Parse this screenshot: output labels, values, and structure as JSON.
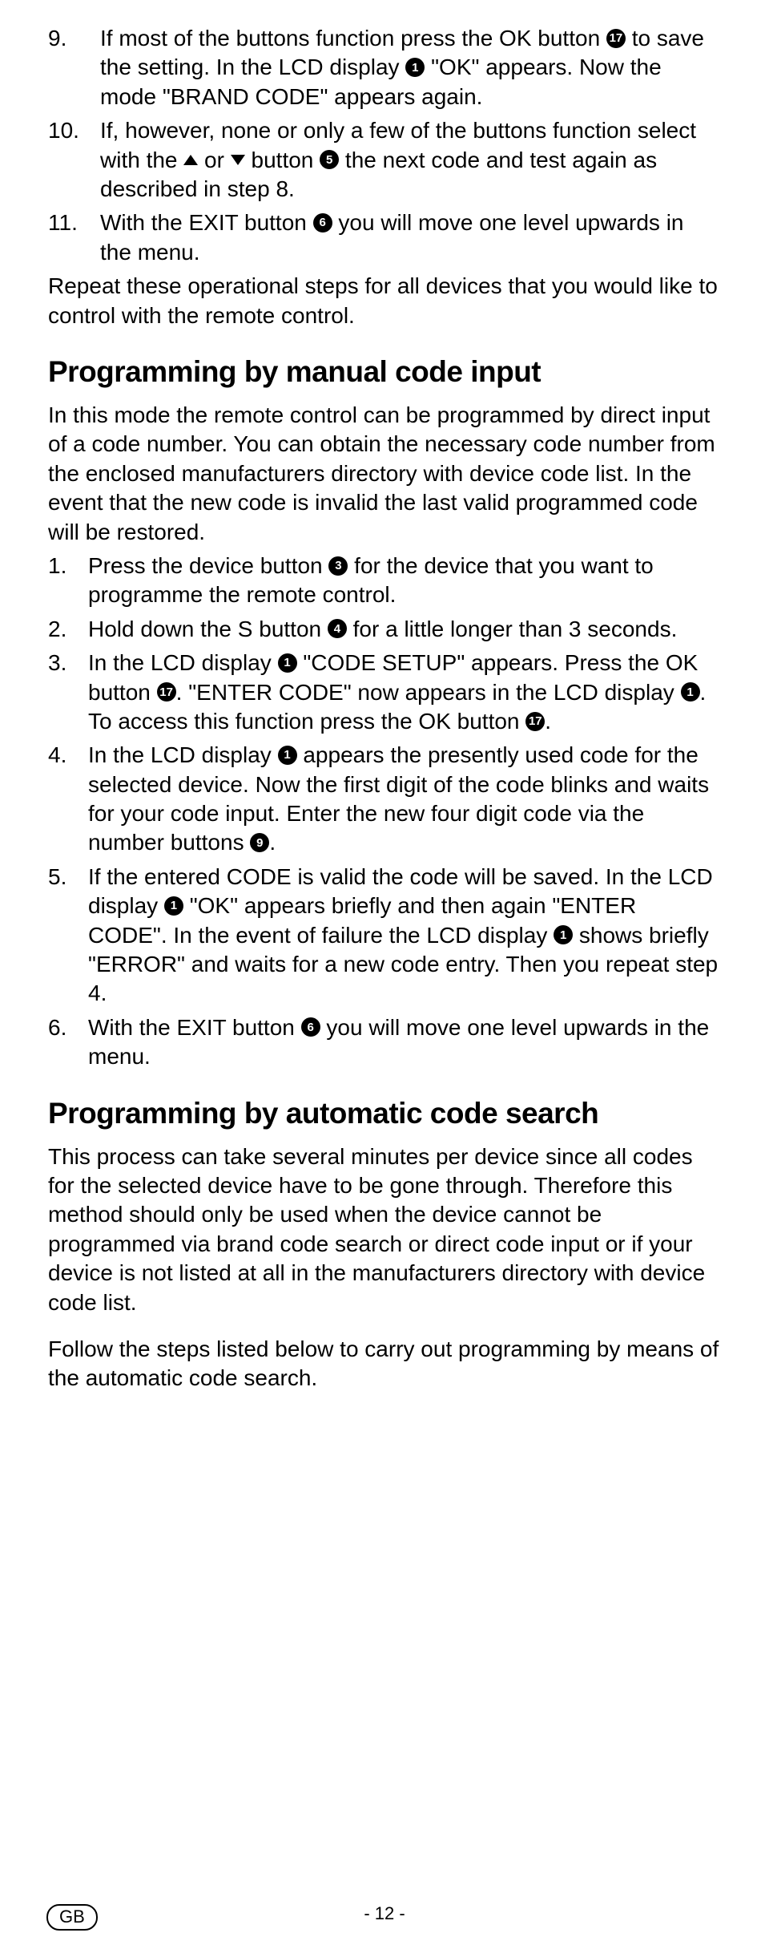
{
  "refs": {
    "r1": "1",
    "r3": "3",
    "r4": "4",
    "r5": "5",
    "r6": "6",
    "r9": "9",
    "r17": "17"
  },
  "section1": {
    "item9": {
      "num": "9.",
      "t1": "If most of the buttons function press the OK button ",
      "t2": " to save the setting. In the LCD display ",
      "t3": " \"OK\" appears. Now the mode \"BRAND CODE\" appears again."
    },
    "item10": {
      "num": "10.",
      "t1": "If, however, none or only a few of the buttons function select with the ",
      "t2": " or ",
      "t3": " button ",
      "t4": " the next code and test again as described in step 8."
    },
    "item11": {
      "num": "11.",
      "t1": "With the EXIT button ",
      "t2": " you will move one level upwards in the menu."
    },
    "outro": "Repeat these operational steps for all devices that you would like to control with the remote control."
  },
  "section2": {
    "heading": "Programming by manual code input",
    "intro": "In this mode the remote control can be programmed by direct input of a code number. You can obtain the necessary code number from the enclosed manufacturers directory with device code list. In the event that the new code is invalid the last valid programmed code will be restored.",
    "item1": {
      "num": "1.",
      "t1": "Press the device button ",
      "t2": " for the device that you want to programme the remote control."
    },
    "item2": {
      "num": "2.",
      "t1": "Hold down the S button ",
      "t2": " for a little longer than 3 seconds."
    },
    "item3": {
      "num": "3.",
      "t1": "In the LCD display ",
      "t2": " \"CODE SETUP\" appears. Press the OK button ",
      "t3": ". \"ENTER CODE\" now appears in the LCD display ",
      "t4": ". To access this function press the OK button ",
      "t5": "."
    },
    "item4": {
      "num": "4.",
      "t1": "In the LCD display ",
      "t2": " appears the presently used code for the selected device. Now the first digit of the code blinks and waits for your code input. Enter the new four digit code via the number buttons ",
      "t3": "."
    },
    "item5": {
      "num": "5.",
      "t1": "If the entered CODE is valid the code will be saved. In the LCD display ",
      "t2": " \"OK\" appears briefly and then again \"ENTER CODE\". In the event of failure the LCD display ",
      "t3": " shows briefly \"ERROR\" and waits for a new code entry. Then you repeat step 4."
    },
    "item6": {
      "num": "6.",
      "t1": "With the EXIT button ",
      "t2": " you will move one level upwards in the menu."
    }
  },
  "section3": {
    "heading": "Programming by automatic code search",
    "p1": "This process can take several minutes per device since all codes for the selected device have to be gone through. Therefore this method should only be used when the device cannot be programmed via brand code search or direct code input or if your device is not listed at all in the manufacturers directory with device code list.",
    "p2": "Follow the steps listed below to carry out programming by means of the automatic code search."
  },
  "footer": {
    "page": "- 12 -",
    "region": "GB"
  }
}
